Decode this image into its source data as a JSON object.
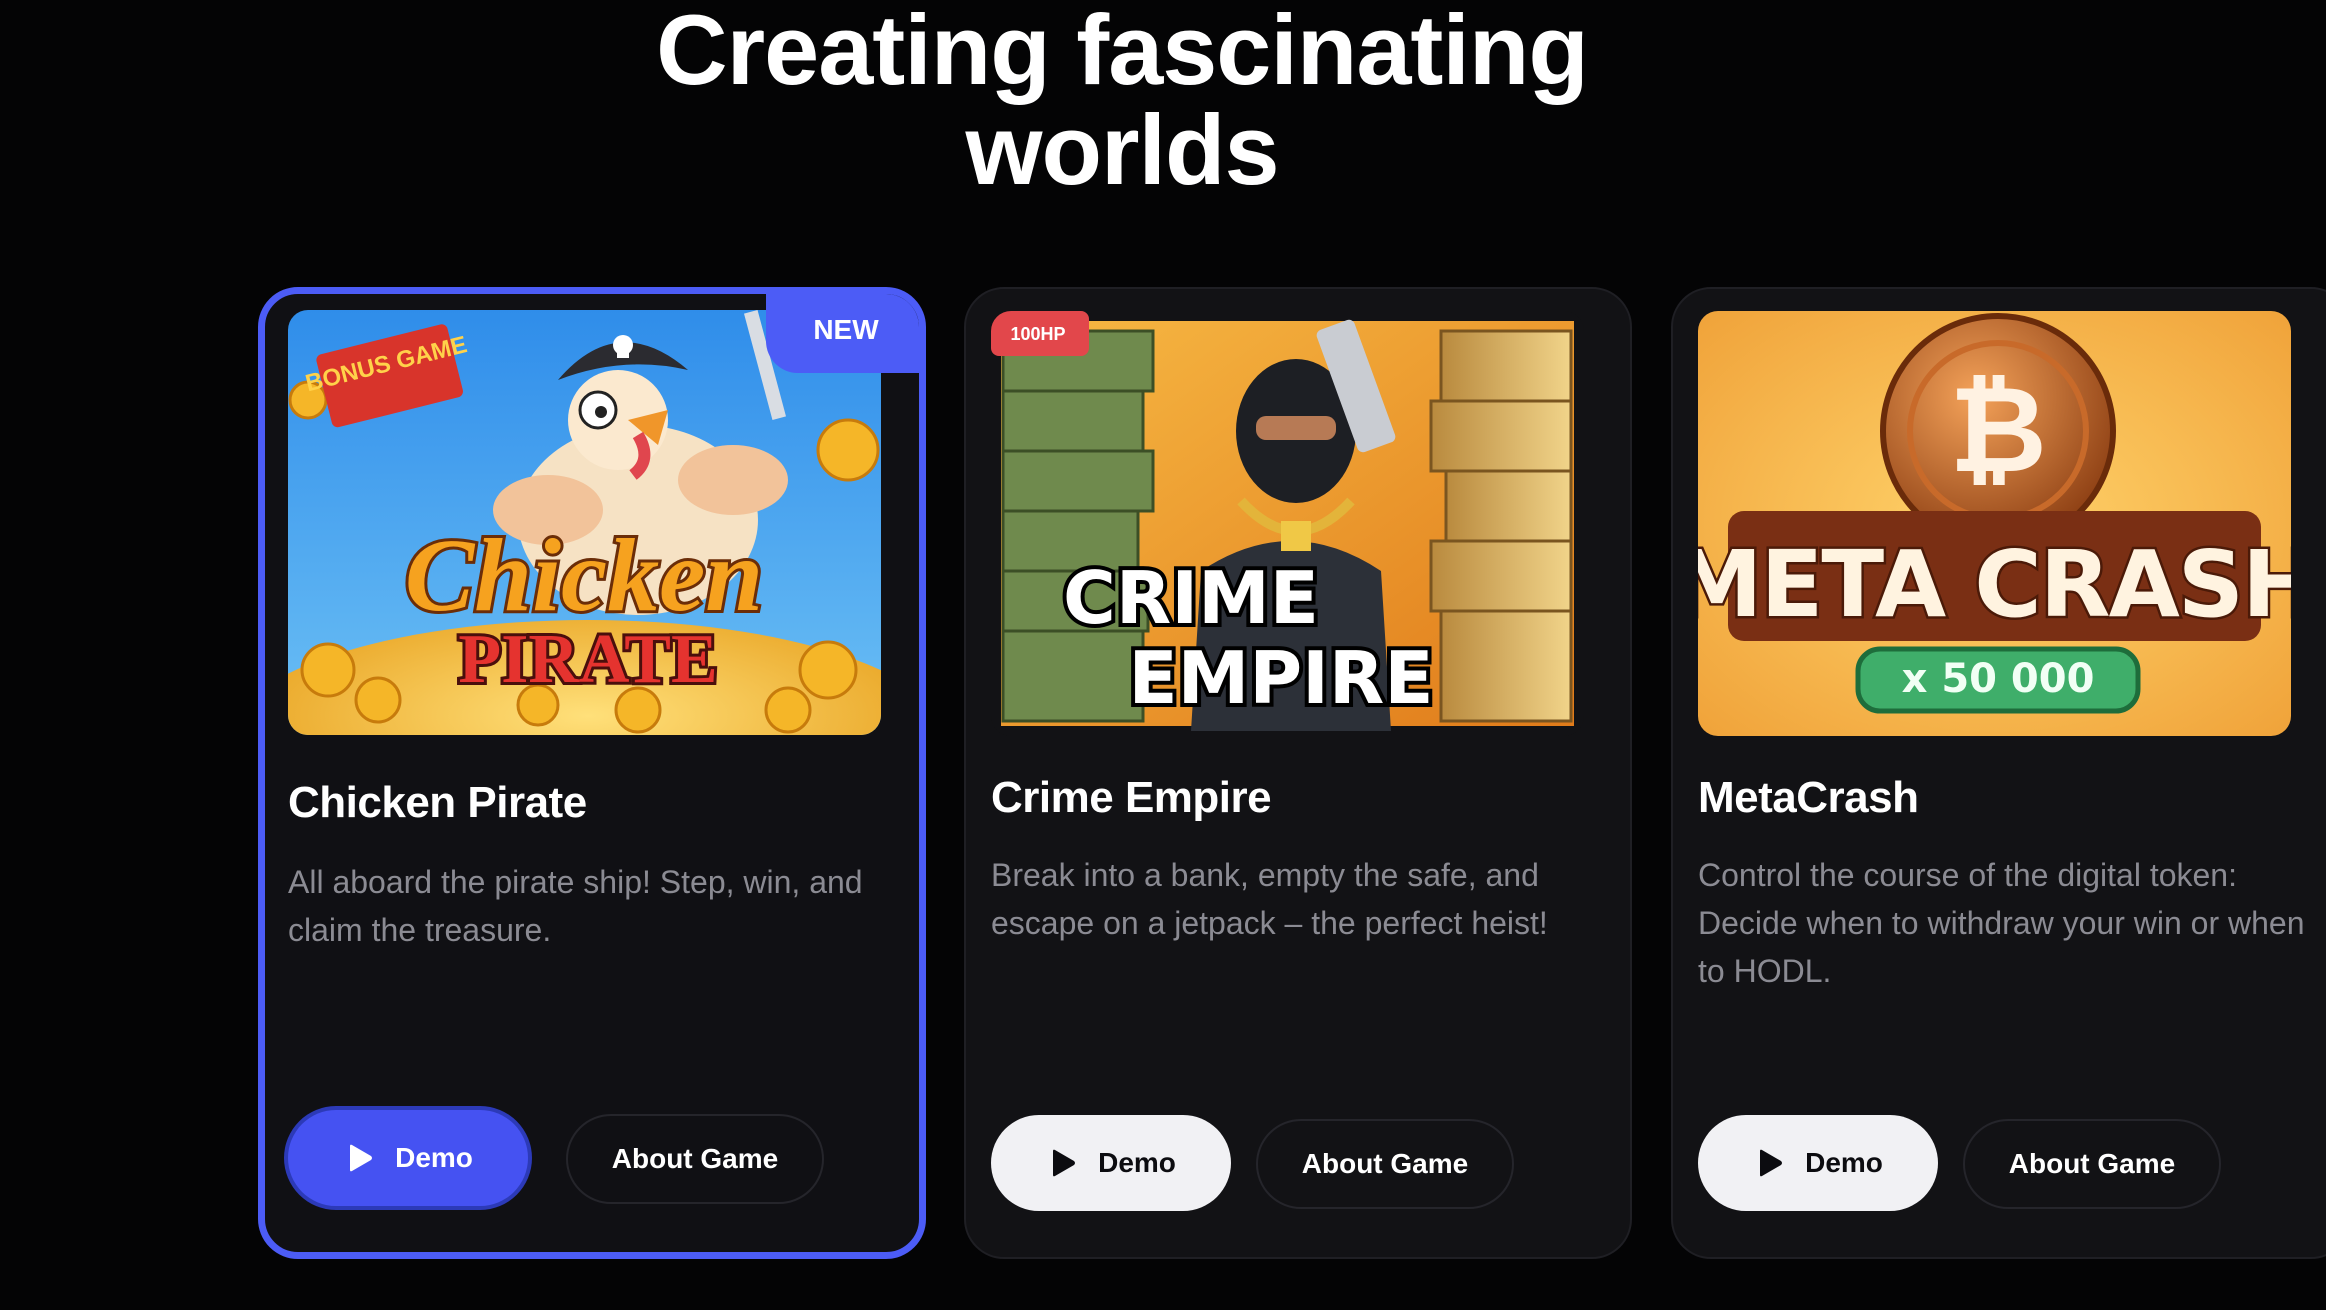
{
  "heading": {
    "line1": "Creating fascinating",
    "line2": "worlds"
  },
  "cards": [
    {
      "title": "Chicken Pirate",
      "description": "All aboard the pirate ship! Step, win, and claim the treasure.",
      "badge": "NEW",
      "image_text": {
        "banner": "BONUS GAME",
        "logo_top": "Chicken",
        "logo_bottom": "PIRATE"
      },
      "demo_label": "Demo",
      "about_label": "About Game",
      "active": true
    },
    {
      "title": "Crime Empire",
      "description": "Break into a bank, empty the safe, and escape on a jetpack – the perfect heist!",
      "image_text": {
        "tag": "100HP",
        "logo_top": "CRIME",
        "logo_bottom": "EMPIRE"
      },
      "demo_label": "Demo",
      "about_label": "About Game",
      "active": false
    },
    {
      "title": "MetaCrash",
      "description": "Control the course of the digital token: Decide when to withdraw your win or when to HODL.",
      "image_text": {
        "logo": "META CRASH",
        "multiplier": "x 50 000"
      },
      "demo_label": "Demo",
      "about_label": "About Game",
      "active": false
    }
  ],
  "colors": {
    "background": "#040405",
    "card": "#121215",
    "accent": "#4c5cf6",
    "muted_text": "#8b8b93"
  },
  "icons": [
    "play-icon",
    "bitcoin-icon",
    "skull-icon"
  ]
}
